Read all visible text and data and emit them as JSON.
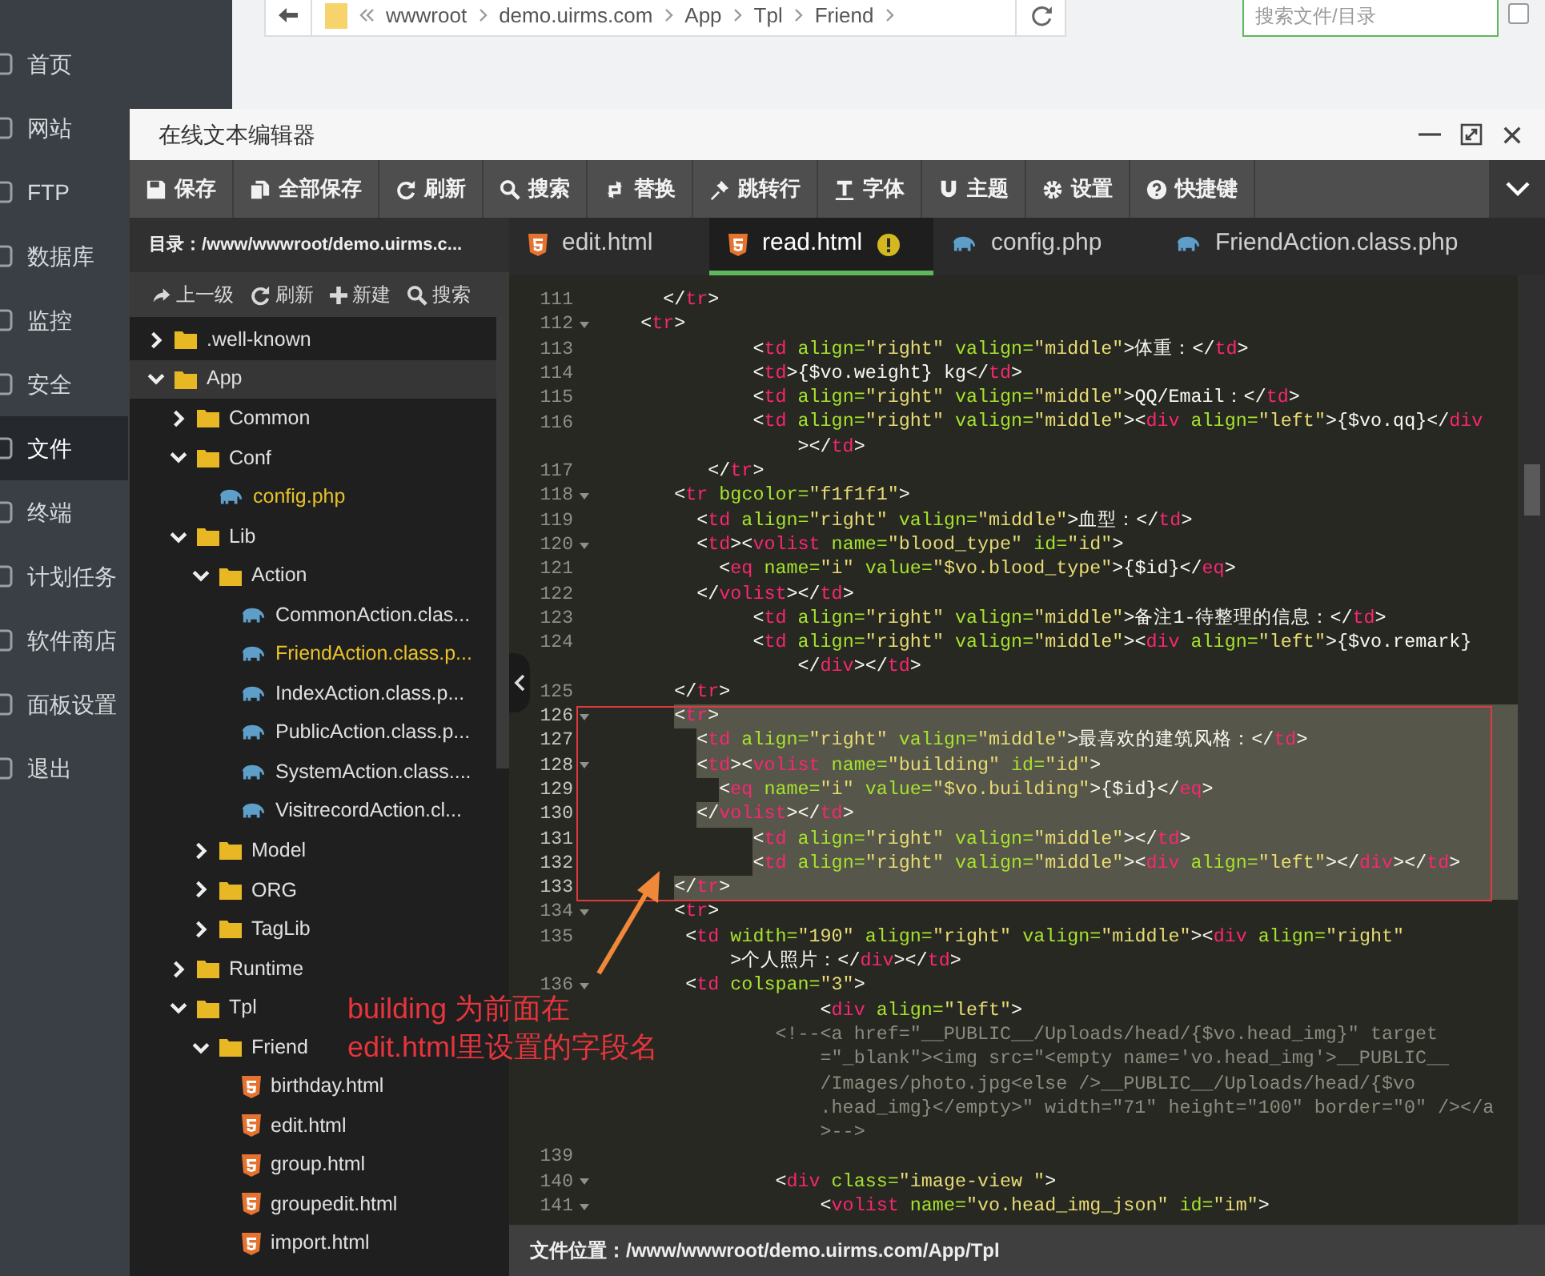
{
  "app_sidebar": {
    "items": [
      {
        "label": "首页",
        "selected": false
      },
      {
        "label": "网站",
        "selected": false
      },
      {
        "label": "FTP",
        "selected": false
      },
      {
        "label": "数据库",
        "selected": false
      },
      {
        "label": "监控",
        "selected": false
      },
      {
        "label": "安全",
        "selected": false
      },
      {
        "label": "文件",
        "selected": true
      },
      {
        "label": "终端",
        "selected": false
      },
      {
        "label": "计划任务",
        "selected": false
      },
      {
        "label": "软件商店",
        "selected": false
      },
      {
        "label": "面板设置",
        "selected": false
      },
      {
        "label": "退出",
        "selected": false
      }
    ]
  },
  "file_browser": {
    "path": [
      "wwwroot",
      "demo.uirms.com",
      "App",
      "Tpl",
      "Friend"
    ],
    "search": {
      "placeholder": "搜索文件/目录"
    },
    "checkbox": {
      "checked": false
    }
  },
  "editor": {
    "title": "在线文本编辑器",
    "toolbar": [
      "保存",
      "全部保存",
      "刷新",
      "搜索",
      "替换",
      "跳转行",
      "字体",
      "主题",
      "设置",
      "快捷键"
    ],
    "directory": "目录：/www/wwwroot/demo.uirms.c...",
    "tree_actions": [
      "上一级",
      "刷新",
      "新建",
      "搜索"
    ],
    "tree": [
      {
        "label": ".well-known",
        "kind": "folder",
        "expanded": false,
        "selected": false,
        "highlighted": false
      },
      {
        "label": "App",
        "kind": "folder",
        "expanded": true,
        "selected": true,
        "highlighted": false,
        "children": [
          {
            "label": "Common",
            "kind": "folder",
            "expanded": false,
            "selected": false,
            "highlighted": false
          },
          {
            "label": "Conf",
            "kind": "folder",
            "expanded": true,
            "selected": false,
            "highlighted": false,
            "children": [
              {
                "label": "config.php",
                "kind": "php",
                "selected": false,
                "highlighted": true
              }
            ]
          },
          {
            "label": "Lib",
            "kind": "folder",
            "expanded": true,
            "selected": false,
            "highlighted": false,
            "children": [
              {
                "label": "Action",
                "kind": "folder",
                "expanded": true,
                "selected": false,
                "highlighted": false,
                "children": [
                  {
                    "label": "CommonAction.clas...",
                    "kind": "php",
                    "selected": false,
                    "highlighted": false
                  },
                  {
                    "label": "FriendAction.class.p...",
                    "kind": "php",
                    "selected": false,
                    "highlighted": true
                  },
                  {
                    "label": "IndexAction.class.p...",
                    "kind": "php",
                    "selected": false,
                    "highlighted": false
                  },
                  {
                    "label": "PublicAction.class.p...",
                    "kind": "php",
                    "selected": false,
                    "highlighted": false
                  },
                  {
                    "label": "SystemAction.class....",
                    "kind": "php",
                    "selected": false,
                    "highlighted": false
                  },
                  {
                    "label": "VisitrecordAction.cl...",
                    "kind": "php",
                    "selected": false,
                    "highlighted": false
                  }
                ]
              },
              {
                "label": "Model",
                "kind": "folder",
                "expanded": false,
                "selected": false,
                "highlighted": false
              },
              {
                "label": "ORG",
                "kind": "folder",
                "expanded": false,
                "selected": false,
                "highlighted": false
              },
              {
                "label": "TagLib",
                "kind": "folder",
                "expanded": false,
                "selected": false,
                "highlighted": false
              }
            ]
          },
          {
            "label": "Runtime",
            "kind": "folder",
            "expanded": false,
            "selected": false,
            "highlighted": false
          },
          {
            "label": "Tpl",
            "kind": "folder",
            "expanded": true,
            "selected": false,
            "highlighted": false,
            "children": [
              {
                "label": "Friend",
                "kind": "folder",
                "expanded": true,
                "selected": false,
                "highlighted": false,
                "children": [
                  {
                    "label": "birthday.html",
                    "kind": "html",
                    "selected": false,
                    "highlighted": false
                  },
                  {
                    "label": "edit.html",
                    "kind": "html",
                    "selected": false,
                    "highlighted": false
                  },
                  {
                    "label": "group.html",
                    "kind": "html",
                    "selected": false,
                    "highlighted": false
                  },
                  {
                    "label": "groupedit.html",
                    "kind": "html",
                    "selected": false,
                    "highlighted": false
                  },
                  {
                    "label": "import.html",
                    "kind": "html",
                    "selected": false,
                    "highlighted": false
                  }
                ]
              }
            ]
          }
        ]
      }
    ],
    "tabs": [
      {
        "label": "edit.html",
        "kind": "html",
        "selected": false,
        "modified": false
      },
      {
        "label": "read.html",
        "kind": "html",
        "selected": true,
        "modified": true
      },
      {
        "label": "config.php",
        "kind": "php",
        "selected": false,
        "modified": false
      },
      {
        "label": "FriendAction.class.php",
        "kind": "php",
        "selected": false,
        "modified": false
      }
    ],
    "code_lines": [
      {
        "number": "111",
        "selected": false,
        "foldable": false,
        "segments": [
          {
            "kind": "text",
            "text": "      </"
          },
          {
            "kind": "tag",
            "text": "tr"
          },
          {
            "kind": "text",
            "text": ">"
          }
        ]
      },
      {
        "number": "112",
        "selected": false,
        "foldable": true,
        "segments": [
          {
            "kind": "text",
            "text": "    <"
          },
          {
            "kind": "tag",
            "text": "tr"
          },
          {
            "kind": "text",
            "text": ">"
          }
        ]
      },
      {
        "number": "113",
        "selected": false,
        "foldable": false,
        "segments": [
          {
            "kind": "text",
            "text": "              <"
          },
          {
            "kind": "tag",
            "text": "td"
          },
          {
            "kind": "attr",
            "text": " align="
          },
          {
            "kind": "string",
            "text": "\"right\""
          },
          {
            "kind": "attr",
            "text": " valign="
          },
          {
            "kind": "string",
            "text": "\"middle\""
          },
          {
            "kind": "text",
            "text": ">体重：</"
          },
          {
            "kind": "tag",
            "text": "td"
          },
          {
            "kind": "text",
            "text": ">"
          }
        ]
      },
      {
        "number": "114",
        "selected": false,
        "foldable": false,
        "segments": [
          {
            "kind": "text",
            "text": "              <"
          },
          {
            "kind": "tag",
            "text": "td"
          },
          {
            "kind": "text",
            "text": ">{$vo.weight} kg</"
          },
          {
            "kind": "tag",
            "text": "td"
          },
          {
            "kind": "text",
            "text": ">"
          }
        ]
      },
      {
        "number": "115",
        "selected": false,
        "foldable": false,
        "segments": [
          {
            "kind": "text",
            "text": "              <"
          },
          {
            "kind": "tag",
            "text": "td"
          },
          {
            "kind": "attr",
            "text": " align="
          },
          {
            "kind": "string",
            "text": "\"right\""
          },
          {
            "kind": "attr",
            "text": " valign="
          },
          {
            "kind": "string",
            "text": "\"middle\""
          },
          {
            "kind": "text",
            "text": ">QQ/Email：</"
          },
          {
            "kind": "tag",
            "text": "td"
          },
          {
            "kind": "text",
            "text": ">"
          }
        ]
      },
      {
        "number": "116",
        "selected": false,
        "foldable": false,
        "segments": [
          {
            "kind": "text",
            "text": "              <"
          },
          {
            "kind": "tag",
            "text": "td"
          },
          {
            "kind": "attr",
            "text": " align="
          },
          {
            "kind": "string",
            "text": "\"right\""
          },
          {
            "kind": "attr",
            "text": " valign="
          },
          {
            "kind": "string",
            "text": "\"middle\""
          },
          {
            "kind": "text",
            "text": "><"
          },
          {
            "kind": "tag",
            "text": "div"
          },
          {
            "kind": "attr",
            "text": " align="
          },
          {
            "kind": "string",
            "text": "\"left\""
          },
          {
            "kind": "text",
            "text": ">{$vo.qq}</"
          },
          {
            "kind": "tag",
            "text": "div"
          }
        ]
      },
      {
        "selected": false,
        "foldable": false,
        "segments": [
          {
            "kind": "text",
            "text": "                  ></"
          },
          {
            "kind": "tag",
            "text": "td"
          },
          {
            "kind": "text",
            "text": ">"
          }
        ]
      },
      {
        "number": "117",
        "selected": false,
        "foldable": false,
        "segments": [
          {
            "kind": "text",
            "text": "          </"
          },
          {
            "kind": "tag",
            "text": "tr"
          },
          {
            "kind": "text",
            "text": ">"
          }
        ]
      },
      {
        "number": "118",
        "selected": false,
        "foldable": true,
        "segments": [
          {
            "kind": "text",
            "text": "       <"
          },
          {
            "kind": "tag",
            "text": "tr"
          },
          {
            "kind": "attr",
            "text": " bgcolor="
          },
          {
            "kind": "string",
            "text": "\"f1f1f1\""
          },
          {
            "kind": "text",
            "text": ">"
          }
        ]
      },
      {
        "number": "119",
        "selected": false,
        "foldable": false,
        "segments": [
          {
            "kind": "text",
            "text": "         <"
          },
          {
            "kind": "tag",
            "text": "td"
          },
          {
            "kind": "attr",
            "text": " align="
          },
          {
            "kind": "string",
            "text": "\"right\""
          },
          {
            "kind": "attr",
            "text": " valign="
          },
          {
            "kind": "string",
            "text": "\"middle\""
          },
          {
            "kind": "text",
            "text": ">血型：</"
          },
          {
            "kind": "tag",
            "text": "td"
          },
          {
            "kind": "text",
            "text": ">"
          }
        ]
      },
      {
        "number": "120",
        "selected": false,
        "foldable": true,
        "segments": [
          {
            "kind": "text",
            "text": "         <"
          },
          {
            "kind": "tag",
            "text": "td"
          },
          {
            "kind": "text",
            "text": "><"
          },
          {
            "kind": "tag",
            "text": "volist"
          },
          {
            "kind": "attr",
            "text": " name="
          },
          {
            "kind": "string",
            "text": "\"blood_type\""
          },
          {
            "kind": "attr",
            "text": " id="
          },
          {
            "kind": "string",
            "text": "\"id\""
          },
          {
            "kind": "text",
            "text": ">"
          }
        ]
      },
      {
        "number": "121",
        "selected": false,
        "foldable": false,
        "segments": [
          {
            "kind": "text",
            "text": "           <"
          },
          {
            "kind": "tag",
            "text": "eq"
          },
          {
            "kind": "attr",
            "text": " name="
          },
          {
            "kind": "string",
            "text": "\"i\""
          },
          {
            "kind": "attr",
            "text": " value="
          },
          {
            "kind": "string",
            "text": "\"$vo.blood_type\""
          },
          {
            "kind": "text",
            "text": ">{$id}</"
          },
          {
            "kind": "tag",
            "text": "eq"
          },
          {
            "kind": "text",
            "text": ">"
          }
        ]
      },
      {
        "number": "122",
        "selected": false,
        "foldable": false,
        "segments": [
          {
            "kind": "text",
            "text": "         </"
          },
          {
            "kind": "tag",
            "text": "volist"
          },
          {
            "kind": "text",
            "text": "></"
          },
          {
            "kind": "tag",
            "text": "td"
          },
          {
            "kind": "text",
            "text": ">"
          }
        ]
      },
      {
        "number": "123",
        "selected": false,
        "foldable": false,
        "segments": [
          {
            "kind": "text",
            "text": "              <"
          },
          {
            "kind": "tag",
            "text": "td"
          },
          {
            "kind": "attr",
            "text": " align="
          },
          {
            "kind": "string",
            "text": "\"right\""
          },
          {
            "kind": "attr",
            "text": " valign="
          },
          {
            "kind": "string",
            "text": "\"middle\""
          },
          {
            "kind": "text",
            "text": ">备注1-待整理的信息：</"
          },
          {
            "kind": "tag",
            "text": "td"
          },
          {
            "kind": "text",
            "text": ">"
          }
        ]
      },
      {
        "number": "124",
        "selected": false,
        "foldable": false,
        "segments": [
          {
            "kind": "text",
            "text": "              <"
          },
          {
            "kind": "tag",
            "text": "td"
          },
          {
            "kind": "attr",
            "text": " align="
          },
          {
            "kind": "string",
            "text": "\"right\""
          },
          {
            "kind": "attr",
            "text": " valign="
          },
          {
            "kind": "string",
            "text": "\"middle\""
          },
          {
            "kind": "text",
            "text": "><"
          },
          {
            "kind": "tag",
            "text": "div"
          },
          {
            "kind": "attr",
            "text": " align="
          },
          {
            "kind": "string",
            "text": "\"left\""
          },
          {
            "kind": "text",
            "text": ">{$vo.remark}"
          }
        ]
      },
      {
        "selected": false,
        "foldable": false,
        "segments": [
          {
            "kind": "text",
            "text": "                  </"
          },
          {
            "kind": "tag",
            "text": "div"
          },
          {
            "kind": "text",
            "text": "></"
          },
          {
            "kind": "tag",
            "text": "td"
          },
          {
            "kind": "text",
            "text": ">"
          }
        ]
      },
      {
        "number": "125",
        "selected": false,
        "foldable": false,
        "segments": [
          {
            "kind": "text",
            "text": "       </"
          },
          {
            "kind": "tag",
            "text": "tr"
          },
          {
            "kind": "text",
            "text": ">"
          }
        ]
      },
      {
        "number": "126",
        "selected": true,
        "foldable": true,
        "segments": [
          {
            "kind": "text",
            "text": "       <"
          },
          {
            "kind": "tag",
            "text": "tr"
          },
          {
            "kind": "text",
            "text": ">"
          }
        ]
      },
      {
        "number": "127",
        "selected": true,
        "foldable": false,
        "segments": [
          {
            "kind": "text",
            "text": "         <"
          },
          {
            "kind": "tag",
            "text": "td"
          },
          {
            "kind": "attr",
            "text": " align="
          },
          {
            "kind": "string",
            "text": "\"right\""
          },
          {
            "kind": "attr",
            "text": " valign="
          },
          {
            "kind": "string",
            "text": "\"middle\""
          },
          {
            "kind": "text",
            "text": ">最喜欢的建筑风格：</"
          },
          {
            "kind": "tag",
            "text": "td"
          },
          {
            "kind": "text",
            "text": ">"
          }
        ]
      },
      {
        "number": "128",
        "selected": true,
        "foldable": true,
        "segments": [
          {
            "kind": "text",
            "text": "         <"
          },
          {
            "kind": "tag",
            "text": "td"
          },
          {
            "kind": "text",
            "text": "><"
          },
          {
            "kind": "tag",
            "text": "volist"
          },
          {
            "kind": "attr",
            "text": " name="
          },
          {
            "kind": "string",
            "text": "\"building\""
          },
          {
            "kind": "attr",
            "text": " id="
          },
          {
            "kind": "string",
            "text": "\"id\""
          },
          {
            "kind": "text",
            "text": ">"
          }
        ]
      },
      {
        "number": "129",
        "selected": true,
        "foldable": false,
        "segments": [
          {
            "kind": "text",
            "text": "           <"
          },
          {
            "kind": "tag",
            "text": "eq"
          },
          {
            "kind": "attr",
            "text": " name="
          },
          {
            "kind": "string",
            "text": "\"i\""
          },
          {
            "kind": "attr",
            "text": " value="
          },
          {
            "kind": "string",
            "text": "\"$vo.building\""
          },
          {
            "kind": "text",
            "text": ">{$id}</"
          },
          {
            "kind": "tag",
            "text": "eq"
          },
          {
            "kind": "text",
            "text": ">"
          }
        ]
      },
      {
        "number": "130",
        "selected": true,
        "foldable": false,
        "segments": [
          {
            "kind": "text",
            "text": "         </"
          },
          {
            "kind": "tag",
            "text": "volist"
          },
          {
            "kind": "text",
            "text": "></"
          },
          {
            "kind": "tag",
            "text": "td"
          },
          {
            "kind": "text",
            "text": ">"
          }
        ]
      },
      {
        "number": "131",
        "selected": true,
        "foldable": false,
        "segments": [
          {
            "kind": "text",
            "text": "              <"
          },
          {
            "kind": "tag",
            "text": "td"
          },
          {
            "kind": "attr",
            "text": " align="
          },
          {
            "kind": "string",
            "text": "\"right\""
          },
          {
            "kind": "attr",
            "text": " valign="
          },
          {
            "kind": "string",
            "text": "\"middle\""
          },
          {
            "kind": "text",
            "text": "></"
          },
          {
            "kind": "tag",
            "text": "td"
          },
          {
            "kind": "text",
            "text": ">"
          }
        ]
      },
      {
        "number": "132",
        "selected": true,
        "foldable": false,
        "segments": [
          {
            "kind": "text",
            "text": "              <"
          },
          {
            "kind": "tag",
            "text": "td"
          },
          {
            "kind": "attr",
            "text": " align="
          },
          {
            "kind": "string",
            "text": "\"right\""
          },
          {
            "kind": "attr",
            "text": " valign="
          },
          {
            "kind": "string",
            "text": "\"middle\""
          },
          {
            "kind": "text",
            "text": "><"
          },
          {
            "kind": "tag",
            "text": "div"
          },
          {
            "kind": "attr",
            "text": " align="
          },
          {
            "kind": "string",
            "text": "\"left\""
          },
          {
            "kind": "text",
            "text": "></"
          },
          {
            "kind": "tag",
            "text": "div"
          },
          {
            "kind": "text",
            "text": "></"
          },
          {
            "kind": "tag",
            "text": "td"
          },
          {
            "kind": "text",
            "text": ">"
          }
        ]
      },
      {
        "number": "133",
        "selected": true,
        "foldable": false,
        "segments": [
          {
            "kind": "text",
            "text": "       </"
          },
          {
            "kind": "tag",
            "text": "tr"
          },
          {
            "kind": "text",
            "text": ">"
          }
        ]
      },
      {
        "number": "134",
        "selected": false,
        "foldable": true,
        "segments": [
          {
            "kind": "text",
            "text": "       <"
          },
          {
            "kind": "tag",
            "text": "tr"
          },
          {
            "kind": "text",
            "text": ">"
          }
        ]
      },
      {
        "number": "135",
        "selected": false,
        "foldable": false,
        "segments": [
          {
            "kind": "text",
            "text": "        <"
          },
          {
            "kind": "tag",
            "text": "td"
          },
          {
            "kind": "attr",
            "text": " width="
          },
          {
            "kind": "string",
            "text": "\"190\""
          },
          {
            "kind": "attr",
            "text": " align="
          },
          {
            "kind": "string",
            "text": "\"right\""
          },
          {
            "kind": "attr",
            "text": " valign="
          },
          {
            "kind": "string",
            "text": "\"middle\""
          },
          {
            "kind": "text",
            "text": "><"
          },
          {
            "kind": "tag",
            "text": "div"
          },
          {
            "kind": "attr",
            "text": " align="
          },
          {
            "kind": "string",
            "text": "\"right\""
          }
        ]
      },
      {
        "selected": false,
        "foldable": false,
        "segments": [
          {
            "kind": "text",
            "text": "            >个人照片：</"
          },
          {
            "kind": "tag",
            "text": "div"
          },
          {
            "kind": "text",
            "text": "></"
          },
          {
            "kind": "tag",
            "text": "td"
          },
          {
            "kind": "text",
            "text": ">"
          }
        ]
      },
      {
        "number": "136",
        "selected": false,
        "foldable": true,
        "segments": [
          {
            "kind": "text",
            "text": "        <"
          },
          {
            "kind": "tag",
            "text": "td"
          },
          {
            "kind": "attr",
            "text": " colspan="
          },
          {
            "kind": "string",
            "text": "\"3\""
          },
          {
            "kind": "text",
            "text": ">"
          }
        ]
      },
      {
        "selected": false,
        "foldable": false,
        "segments": [
          {
            "kind": "text",
            "text": "                    <"
          },
          {
            "kind": "tag",
            "text": "div"
          },
          {
            "kind": "attr",
            "text": " align="
          },
          {
            "kind": "string",
            "text": "\"left\""
          },
          {
            "kind": "text",
            "text": ">"
          }
        ]
      },
      {
        "selected": false,
        "foldable": false,
        "segments": [
          {
            "kind": "comment",
            "text": "                <!--<a href=\"__PUBLIC__/Uploads/head/{$vo.head_img}\" target"
          }
        ]
      },
      {
        "selected": false,
        "foldable": false,
        "segments": [
          {
            "kind": "comment",
            "text": "                    =\"_blank\"><img src=\"<empty name='vo.head_img'>__PUBLIC__"
          }
        ]
      },
      {
        "selected": false,
        "foldable": false,
        "segments": [
          {
            "kind": "comment",
            "text": "                    /Images/photo.jpg<else />__PUBLIC__/Uploads/head/{$vo"
          }
        ]
      },
      {
        "selected": false,
        "foldable": false,
        "segments": [
          {
            "kind": "comment",
            "text": "                    .head_img}</empty>\" width=\"71\" height=\"100\" border=\"0\" /></a"
          }
        ]
      },
      {
        "selected": false,
        "foldable": false,
        "segments": [
          {
            "kind": "comment",
            "text": "                    >-->"
          }
        ]
      },
      {
        "number": "139",
        "selected": false,
        "foldable": false
      },
      {
        "number": "140",
        "selected": false,
        "foldable": true,
        "segments": [
          {
            "kind": "text",
            "text": "                <"
          },
          {
            "kind": "tag",
            "text": "div"
          },
          {
            "kind": "attr",
            "text": " class="
          },
          {
            "kind": "string",
            "text": "\"image-view \""
          },
          {
            "kind": "text",
            "text": ">"
          }
        ]
      },
      {
        "number": "141",
        "selected": false,
        "foldable": true,
        "segments": [
          {
            "kind": "text",
            "text": "                    <"
          },
          {
            "kind": "tag",
            "text": "volist"
          },
          {
            "kind": "attr",
            "text": " name="
          },
          {
            "kind": "string",
            "text": "\"vo.head_img_json\""
          },
          {
            "kind": "attr",
            "text": " id="
          },
          {
            "kind": "string",
            "text": "\"im\""
          },
          {
            "kind": "text",
            "text": ">"
          }
        ]
      }
    ],
    "status_bar": "文件位置：/www/wwwroot/demo.uirms.com/App/Tpl"
  },
  "annotation": {
    "lines": [
      "building 为前面在",
      "edit.html里设置的字段名"
    ]
  }
}
